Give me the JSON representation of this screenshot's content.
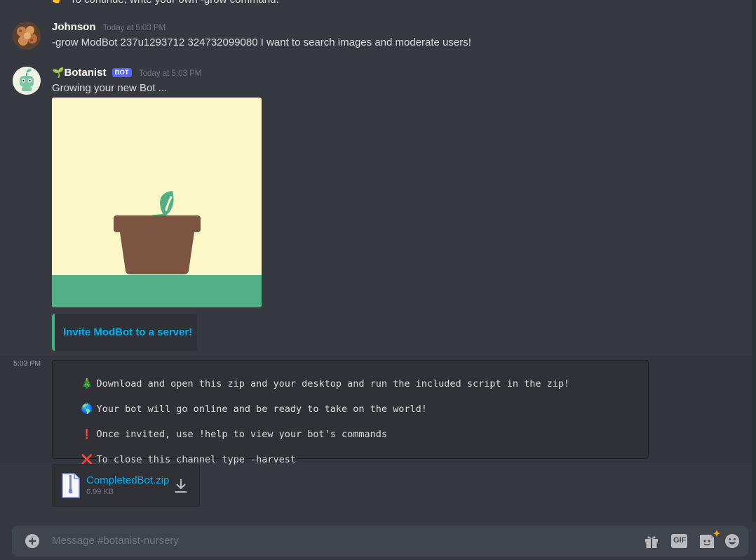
{
  "top_partial": {
    "text": "To continue, write your own -grow command."
  },
  "messages": [
    {
      "author": "Johnson",
      "timestamp": "Today at 5:03 PM",
      "content": "-grow ModBot 237u1293712 324732099080 I want to search images and moderate users!"
    },
    {
      "author": "Botanist",
      "author_prefix_emoji": "🌱",
      "badge": "BOT",
      "timestamp": "Today at 5:03 PM",
      "content": "Growing your new Bot ...",
      "embed_link": "Invite ModBot to a server!"
    }
  ],
  "followup": {
    "timestamp": "5:03 PM",
    "code_lines": [
      {
        "emoji": "🎄",
        "text": "Download and open this zip and your desktop and run the included script in the zip!"
      },
      {
        "emoji": "🌎",
        "text": "Your bot will go online and be ready to take on the world!"
      },
      {
        "emoji": "❗",
        "text": "Once invited, use !help to view your bot's commands"
      },
      {
        "emoji": "❌",
        "text": "To close this channel type -harvest"
      }
    ],
    "attachment": {
      "name": "CompletedBot.zip",
      "size": "6.99 KB"
    }
  },
  "composer": {
    "placeholder": "Message #botanist-nursery",
    "gif_label": "GIF"
  },
  "colors": {
    "background": "#36393f",
    "accent_link": "#00b0f4",
    "embed_border": "#43b581",
    "bot_badge": "#5865f2",
    "pot": "#7b5541",
    "sprout": "#52b089",
    "sky": "#fdf8c8"
  }
}
